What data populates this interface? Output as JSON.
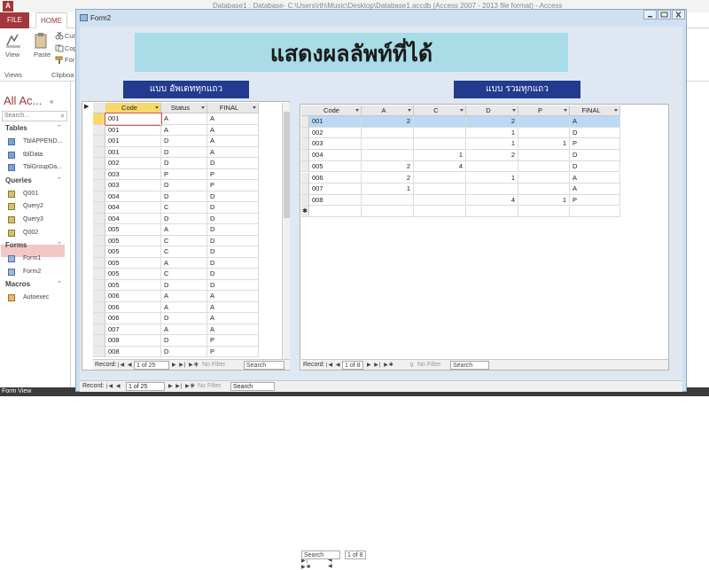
{
  "window": {
    "app_icon": "A",
    "title": "Database1 : Database- C:\\Users\\rth\\Music\\Desktop\\Database1.accdb (Access 2007 - 2013 file format) - Access"
  },
  "ribbon": {
    "tabs": [
      "FILE",
      "HOME"
    ],
    "view_label": "View",
    "views_group": "Views",
    "paste_label": "Paste",
    "cut_label": "Cut",
    "copy_label": "Cop",
    "format_label": "For",
    "clipboard_group": "Clipboa"
  },
  "nav": {
    "title": "All Ac...",
    "search_placeholder": "Search...",
    "groups": [
      {
        "name": "Tables",
        "icon": "table-icon",
        "items": [
          "TblAPPEND...",
          "tblData",
          "TblGroupDa..."
        ]
      },
      {
        "name": "Queries",
        "icon": "query-icon",
        "items": [
          "Q001",
          "Query2",
          "Query3",
          "Q002"
        ]
      },
      {
        "name": "Forms",
        "icon": "form-icon",
        "items": [
          "Form1",
          "Form2"
        ]
      },
      {
        "name": "Macros",
        "icon": "macro-icon",
        "items": [
          "Autoexec"
        ]
      }
    ],
    "selected_item": "Form1"
  },
  "status": {
    "text": "Form View"
  },
  "form": {
    "tab_title": "Form2",
    "heading": "แสดงผลลัพท์ที่ได้",
    "left_label": "แบบ อัพเดททุกแถว",
    "right_label": "แบบ รวมทุกแถว",
    "left_grid": {
      "columns": [
        "Code",
        "Status",
        "FINAL"
      ],
      "rows": [
        [
          "001",
          "A",
          "A"
        ],
        [
          "001",
          "A",
          "A"
        ],
        [
          "001",
          "D",
          "A"
        ],
        [
          "001",
          "D",
          "A"
        ],
        [
          "002",
          "D",
          "D"
        ],
        [
          "003",
          "P",
          "P"
        ],
        [
          "003",
          "D",
          "P"
        ],
        [
          "004",
          "D",
          "D"
        ],
        [
          "004",
          "C",
          "D"
        ],
        [
          "004",
          "D",
          "D"
        ],
        [
          "005",
          "A",
          "D"
        ],
        [
          "005",
          "C",
          "D"
        ],
        [
          "005",
          "C",
          "D"
        ],
        [
          "005",
          "A",
          "D"
        ],
        [
          "005",
          "C",
          "D"
        ],
        [
          "005",
          "D",
          "D"
        ],
        [
          "006",
          "A",
          "A"
        ],
        [
          "006",
          "A",
          "A"
        ],
        [
          "006",
          "D",
          "A"
        ],
        [
          "007",
          "A",
          "A"
        ],
        [
          "008",
          "D",
          "P"
        ],
        [
          "008",
          "D",
          "P"
        ]
      ],
      "record_label": "Record:",
      "record_pos": "1 of 25",
      "filter": "No Filter",
      "search": "Search"
    },
    "right_grid": {
      "columns": [
        "Code",
        "A",
        "C",
        "D",
        "P",
        "FINAL"
      ],
      "rows": [
        [
          "001",
          "2",
          "",
          "2",
          "",
          "A"
        ],
        [
          "002",
          "",
          "",
          "1",
          "",
          "D"
        ],
        [
          "003",
          "",
          "",
          "1",
          "1",
          "P"
        ],
        [
          "004",
          "",
          "1",
          "2",
          "",
          "D"
        ],
        [
          "005",
          "2",
          "4",
          "",
          "",
          "D"
        ],
        [
          "006",
          "2",
          "",
          "1",
          "",
          "A"
        ],
        [
          "007",
          "1",
          "",
          "",
          "",
          "A"
        ],
        [
          "008",
          "",
          "",
          "4",
          "1",
          "P"
        ]
      ],
      "new_row_marker": "✱",
      "record_label": "Record:",
      "record_pos": "1 of 8",
      "filter": "No Filter",
      "search": "Search"
    },
    "main_nav": {
      "record_label": "Record:",
      "record_pos": "1 of 25",
      "filter": "No Filter",
      "search": "Search"
    }
  }
}
